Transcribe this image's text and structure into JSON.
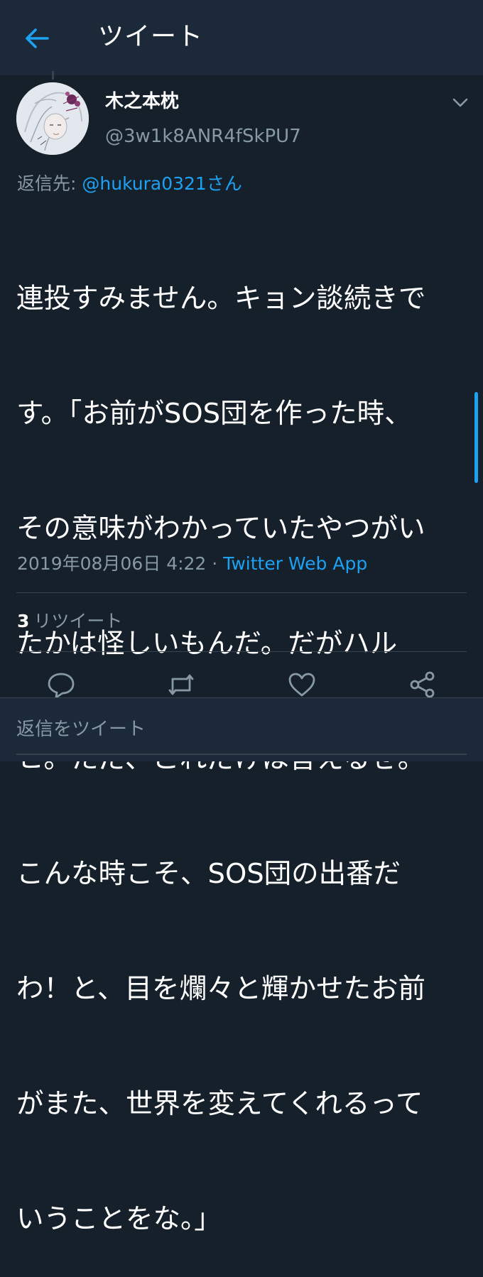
{
  "header": {
    "title": "ツイート",
    "back_icon": "arrow-left-icon",
    "accent": "#1da1f2"
  },
  "tweet": {
    "author_name": "木之本枕",
    "author_handle": "@3w1k8ANR4fSkPU7",
    "reply_prefix": "返信先: ",
    "reply_to": "@hukura0321さん",
    "text_lines": [
      "連投すみません。キョン談続きで",
      "す。「お前がSOS団を作った時、",
      "その意味がわかっていたやつがい",
      "たかは怪しいもんだ。だがハル",
      "ヒ。ただ、これだけは言えるぜ。",
      "こんな時こそ、SOS団の出番だ",
      "わ！と、目を爛々と輝かせたお前",
      "がまた、世界を変えてくれるって",
      "いうことをな。」"
    ],
    "timestamp": "2019年08月06日 4:22",
    "separator": " · ",
    "source": "Twitter Web App"
  },
  "stats": {
    "retweet_count": "3",
    "retweet_label": "リツイート"
  },
  "actions": [
    "reply-icon",
    "retweet-icon",
    "like-icon",
    "share-icon"
  ],
  "composer": {
    "placeholder": "返信をツイート"
  },
  "colors": {
    "background": "#15202b",
    "bar": "#1c2938",
    "secondary_text": "#8899a6",
    "divider": "#38444d"
  }
}
